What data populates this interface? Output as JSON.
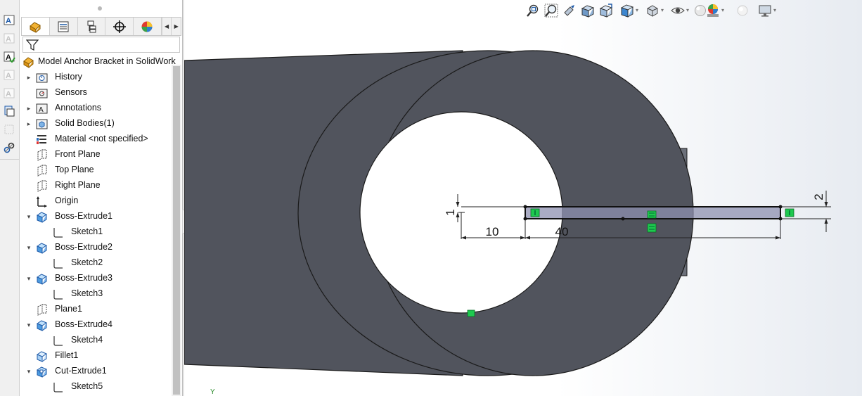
{
  "colors": {
    "model_face": "#51545d",
    "model_side": "#6c707a",
    "sketch_fill": "#8d90b0",
    "relation_green": "#1ec94f",
    "accent_blue": "#1e5aa8"
  },
  "left_toolbar": {
    "items": [
      {
        "icon": "smart-dimension-icon",
        "state": "active"
      },
      {
        "icon": "model-items-icon",
        "state": "disabled"
      },
      {
        "icon": "spell-checker-icon",
        "state": "active"
      },
      {
        "icon": "format-painter-icon",
        "state": "disabled"
      },
      {
        "icon": "note-icon",
        "state": "disabled"
      },
      {
        "icon": "balloon-icon",
        "state": "active"
      },
      {
        "icon": "auto-balloon-icon",
        "state": "disabled"
      },
      {
        "icon": "magnetic-line-icon",
        "state": "active"
      }
    ]
  },
  "feature_manager": {
    "tabs": [
      {
        "icon": "feature-manager-tab-icon",
        "active": true
      },
      {
        "icon": "property-manager-tab-icon",
        "active": false
      },
      {
        "icon": "configuration-manager-tab-icon",
        "active": false
      },
      {
        "icon": "dimxpert-manager-tab-icon",
        "active": false
      },
      {
        "icon": "display-manager-tab-icon",
        "active": false
      }
    ],
    "filter_icon": "filter-icon",
    "root": {
      "label": "Model Anchor Bracket in SolidWork",
      "icon": "part-icon"
    },
    "items": [
      {
        "label": "History",
        "icon": "history-folder-icon",
        "expander": "collapsed",
        "indent": 0
      },
      {
        "label": "Sensors",
        "icon": "sensors-icon",
        "expander": "none",
        "indent": 0
      },
      {
        "label": "Annotations",
        "icon": "annotations-icon",
        "expander": "collapsed",
        "indent": 0
      },
      {
        "label": "Solid Bodies(1)",
        "icon": "solid-bodies-icon",
        "expander": "collapsed",
        "indent": 0
      },
      {
        "label": "Material <not specified>",
        "icon": "material-icon",
        "expander": "none",
        "indent": 0
      },
      {
        "label": "Front Plane",
        "icon": "plane-icon",
        "expander": "none",
        "indent": 0
      },
      {
        "label": "Top Plane",
        "icon": "plane-icon",
        "expander": "none",
        "indent": 0
      },
      {
        "label": "Right Plane",
        "icon": "plane-icon",
        "expander": "none",
        "indent": 0
      },
      {
        "label": "Origin",
        "icon": "origin-icon",
        "expander": "none",
        "indent": 0
      },
      {
        "label": "Boss-Extrude1",
        "icon": "extrude-icon",
        "expander": "expanded",
        "indent": 0
      },
      {
        "label": "Sketch1",
        "icon": "sketch-icon",
        "expander": "none",
        "indent": 1
      },
      {
        "label": "Boss-Extrude2",
        "icon": "extrude-icon",
        "expander": "expanded",
        "indent": 0
      },
      {
        "label": "Sketch2",
        "icon": "sketch-icon",
        "expander": "none",
        "indent": 1
      },
      {
        "label": "Boss-Extrude3",
        "icon": "extrude-icon",
        "expander": "expanded",
        "indent": 0
      },
      {
        "label": "Sketch3",
        "icon": "sketch-icon",
        "expander": "none",
        "indent": 1
      },
      {
        "label": "Plane1",
        "icon": "plane-icon",
        "expander": "none",
        "indent": 0
      },
      {
        "label": "Boss-Extrude4",
        "icon": "extrude-icon",
        "expander": "expanded",
        "indent": 0
      },
      {
        "label": "Sketch4",
        "icon": "sketch-icon",
        "expander": "none",
        "indent": 1
      },
      {
        "label": "Fillet1",
        "icon": "fillet-icon",
        "expander": "none",
        "indent": 0
      },
      {
        "label": "Cut-Extrude1",
        "icon": "cut-extrude-icon",
        "expander": "expanded",
        "indent": 0
      },
      {
        "label": "Sketch5",
        "icon": "sketch-icon",
        "expander": "none",
        "indent": 1
      }
    ]
  },
  "view_toolbar": {
    "items": [
      {
        "icon": "zoom-to-fit-icon",
        "dropdown": false
      },
      {
        "icon": "zoom-to-area-icon",
        "dropdown": false
      },
      {
        "icon": "previous-view-icon",
        "dropdown": false
      },
      {
        "icon": "section-view-icon",
        "dropdown": false
      },
      {
        "icon": "dynamic-annotation-views-icon",
        "dropdown": false
      },
      {
        "icon": "view-orientation-icon",
        "dropdown": true
      },
      {
        "icon": "display-style-icon",
        "dropdown": true
      },
      {
        "icon": "hide-show-items-icon",
        "dropdown": true
      },
      {
        "icon": "edit-appearance-icon",
        "dropdown": false
      },
      {
        "icon": "apply-scene-icon",
        "dropdown": true
      },
      {
        "icon": "view-settings-icon",
        "dropdown": false
      },
      {
        "icon": "display-monitor-icon",
        "dropdown": true
      }
    ]
  },
  "dimensions": [
    {
      "name": "dimension-1",
      "value": "1"
    },
    {
      "name": "dimension-2",
      "value": "2"
    },
    {
      "name": "dimension-10",
      "value": "10"
    },
    {
      "name": "dimension-40",
      "value": "40"
    }
  ],
  "axis_label": "Y"
}
